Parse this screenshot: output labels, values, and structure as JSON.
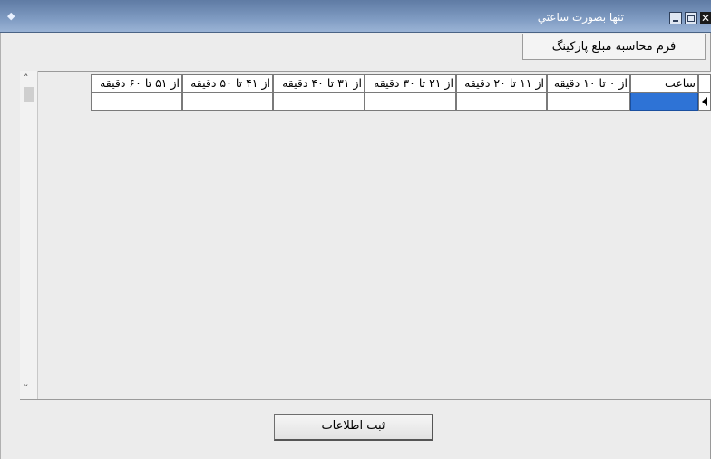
{
  "window": {
    "title": "تنها بصورت ساعتي",
    "app_icon": "diamond-icon",
    "title_bar_color": "#6f8bb5"
  },
  "header": {
    "form_title_button": "فرم محاسبه مبلغ پارکینگ"
  },
  "grid": {
    "columns": [
      "ساعت",
      "از ۰ تا ۱۰ دقیقه",
      "از ۱۱ تا ۲۰ دقیقه",
      "از ۲۱ تا ۳۰ دقیقه",
      "از ۳۱ تا ۴۰ دقیقه",
      "از ۴۱ تا ۵۰ دقیقه",
      "از ۵۱ تا ۶۰ دقیقه"
    ],
    "rows": [
      [
        "",
        "",
        "",
        "",
        "",
        "",
        ""
      ]
    ],
    "selected_cell_color": "#2e73d6"
  },
  "footer": {
    "submit_label": "ثبت اطلاعات"
  }
}
